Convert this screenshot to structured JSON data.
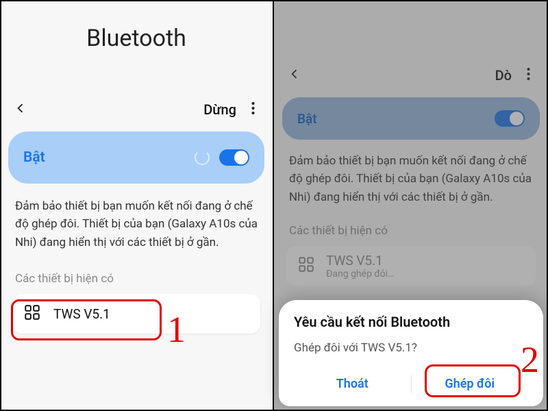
{
  "left": {
    "title": "Bluetooth",
    "stop": "Dừng",
    "on_label": "Bật",
    "description": "Đảm bảo thiết bị bạn muốn kết nối đang ở chế độ ghép đôi. Thiết bị của bạn (Galaxy A10s của Nhi) đang hiển thị với các thiết bị ở gần.",
    "section": "Các thiết bị hiện có",
    "device": "TWS V5.1"
  },
  "right": {
    "scan": "Dò",
    "on_label": "Bật",
    "description": "Đảm bảo thiết bị bạn muốn kết nối đang ở chế độ ghép đôi. Thiết bị của bạn (Galaxy A10s của Nhi) đang hiển thị với các thiết bị ở gần.",
    "section": "Các thiết bị hiện có",
    "device": "TWS V5.1",
    "device_status": "Đang ghép đôi…",
    "sheet_title": "Yêu cầu kết nối Bluetooth",
    "sheet_msg": "Ghép đôi với TWS V5.1?",
    "btn_cancel": "Thoát",
    "btn_pair": "Ghép đôi"
  },
  "annotations": {
    "one": "1",
    "two": "2"
  }
}
